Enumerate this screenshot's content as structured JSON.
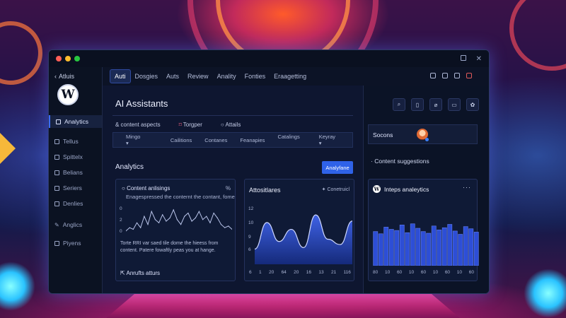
{
  "colors": {
    "accent": "#2f62e8",
    "window_bg": "#0c1326",
    "chart_fill": "#2a49c8",
    "dot_red": "#ff5f57",
    "dot_yellow": "#febc2e",
    "dot_green": "#28c840"
  },
  "sidebar": {
    "top_label": "Atluis",
    "items": [
      {
        "label": "Analytics",
        "icon": "analytics-icon",
        "active": true
      },
      {
        "label": "Tellus"
      },
      {
        "label": "Spittelx"
      },
      {
        "label": "Belians"
      },
      {
        "label": "Seriers"
      },
      {
        "label": "Denlies"
      },
      {
        "label": "Anglics"
      },
      {
        "label": "Piyens"
      }
    ]
  },
  "topnav": [
    "Auti",
    "Dosgies",
    "Auts",
    "Review",
    "Anality",
    "Fonties",
    "Eraagetting"
  ],
  "main": {
    "title": "AI Assistants",
    "filters": [
      "& content aspects",
      "Torgper",
      "Attails"
    ],
    "toolbar": {
      "left": [
        "Mingo",
        "Cailitions",
        "Contanes",
        "Feanapies"
      ],
      "right": [
        "Catalings",
        "Keyray"
      ]
    },
    "analytics_heading": "Analytics",
    "analytics_button": "Analyfane",
    "card1": {
      "title": "Content anlisings",
      "percent": "%",
      "subtitle": "Enagespressed the conternt the contant, fome",
      "y_labels": [
        "0",
        "2",
        "0"
      ],
      "description": "Torte RRI var saed tile dome the hieess from content. Patere fowaftly peas you at hange.",
      "footer": "Anrufts atturs"
    },
    "card2": {
      "title": "Attositlares",
      "right_label": "Conetruicl",
      "y_labels": [
        "12",
        "10",
        "9",
        "6"
      ],
      "x_labels": [
        "6",
        "1",
        "20",
        "64",
        "20",
        "16",
        "13",
        "21",
        "116"
      ]
    }
  },
  "right_panel": {
    "icons": [
      "search-icon",
      "document-icon",
      "paperclip-icon",
      "folder-icon",
      "plugin-icon"
    ],
    "box_label": "Socons",
    "suggestion": "Content suggestions",
    "card_title": "Inteps analeytics",
    "card_menu": "···",
    "x_labels": [
      "80",
      "10",
      "60",
      "10",
      "60",
      "10",
      "60",
      "10",
      "60"
    ]
  },
  "chart_data": [
    {
      "type": "line",
      "title": "Content anlisings",
      "x": [
        1,
        2,
        3,
        4,
        5,
        6,
        7,
        8,
        9,
        10,
        11,
        12,
        13,
        14,
        15,
        16,
        17,
        18,
        19,
        20,
        21,
        22,
        23,
        24,
        25,
        26,
        27,
        28,
        29,
        30
      ],
      "values": [
        0.4,
        0.6,
        0.5,
        0.9,
        0.6,
        1.3,
        0.8,
        1.6,
        1.1,
        0.9,
        1.4,
        1.0,
        1.2,
        1.7,
        1.1,
        0.8,
        1.3,
        1.5,
        1.0,
        1.2,
        1.6,
        1.1,
        1.3,
        0.9,
        1.5,
        1.2,
        0.8,
        0.6,
        0.7,
        0.5
      ],
      "ylim": [
        0,
        2
      ]
    },
    {
      "type": "area",
      "title": "Attositlares",
      "categories": [
        "6",
        "1",
        "20",
        "64",
        "20",
        "16",
        "13",
        "21",
        "116"
      ],
      "values": [
        7,
        10.5,
        8,
        9.6,
        7.2,
        11.5,
        8.3,
        7.6,
        10.7
      ],
      "ylim": [
        5,
        13
      ]
    },
    {
      "type": "bar",
      "title": "Inteps analeytics",
      "categories": [
        "80",
        "10",
        "60",
        "10",
        "60",
        "10",
        "60",
        "10",
        "60"
      ],
      "values": [
        6.2,
        5.8,
        7.0,
        6.6,
        6.4,
        7.4,
        6.0,
        7.6,
        6.8,
        6.2,
        5.9,
        7.2,
        6.5,
        6.9,
        7.5,
        6.3,
        5.7,
        7.1,
        6.7,
        6.1
      ],
      "ylim": [
        0,
        10
      ]
    }
  ]
}
